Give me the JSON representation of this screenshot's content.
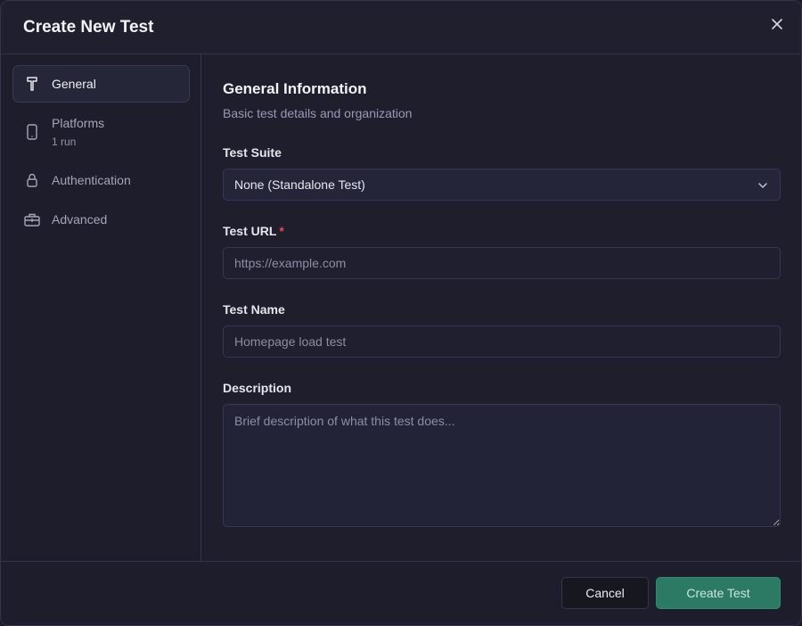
{
  "dialog": {
    "title": "Create New Test"
  },
  "sidebar": {
    "items": [
      {
        "label": "General",
        "sub": "",
        "icon": "hammer-icon",
        "active": true
      },
      {
        "label": "Platforms",
        "sub": "1 run",
        "icon": "smartphone-icon",
        "active": false
      },
      {
        "label": "Authentication",
        "sub": "",
        "icon": "lock-icon",
        "active": false
      },
      {
        "label": "Advanced",
        "sub": "",
        "icon": "toolbox-icon",
        "active": false
      }
    ]
  },
  "section": {
    "title": "General Information",
    "subtitle": "Basic test details and organization"
  },
  "form": {
    "suite": {
      "label": "Test Suite",
      "value": "None (Standalone Test)"
    },
    "url": {
      "label": "Test URL",
      "required": "*",
      "placeholder": "https://example.com"
    },
    "name": {
      "label": "Test Name",
      "placeholder": "Homepage load test"
    },
    "description": {
      "label": "Description",
      "placeholder": "Brief description of what this test does..."
    }
  },
  "footer": {
    "cancel_label": "Cancel",
    "create_label": "Create Test"
  },
  "colors": {
    "accent": "#2c7a64",
    "required": "#e5484d",
    "background": "#1e1e2d"
  }
}
